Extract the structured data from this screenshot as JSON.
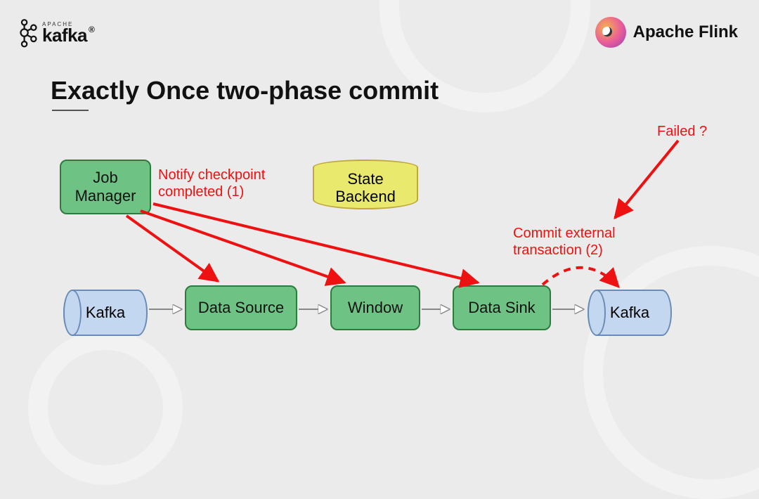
{
  "brand": {
    "kafka_small": "APACHE",
    "kafka": "kafka",
    "kafka_reg": "®",
    "flink": "Apache Flink"
  },
  "title": "Exactly Once two-phase commit",
  "nodes": {
    "job_manager": "Job\nManager",
    "state_backend": "State\nBackend",
    "kafka_src": "Kafka",
    "data_source": "Data Source",
    "window": "Window",
    "data_sink": "Data Sink",
    "kafka_sink": "Kafka"
  },
  "annotations": {
    "notify": "Notify checkpoint\ncompleted (1)",
    "commit": "Commit external\ntransaction (2)",
    "failed": "Failed ?"
  },
  "colors": {
    "green_fill": "#6ec384",
    "green_stroke": "#2f7a3f",
    "yellow_fill": "#e9e96d",
    "yellow_stroke": "#c0a83c",
    "blue_fill": "#c3d8f0",
    "blue_stroke": "#6a8bb5",
    "red": "#ee1111"
  }
}
